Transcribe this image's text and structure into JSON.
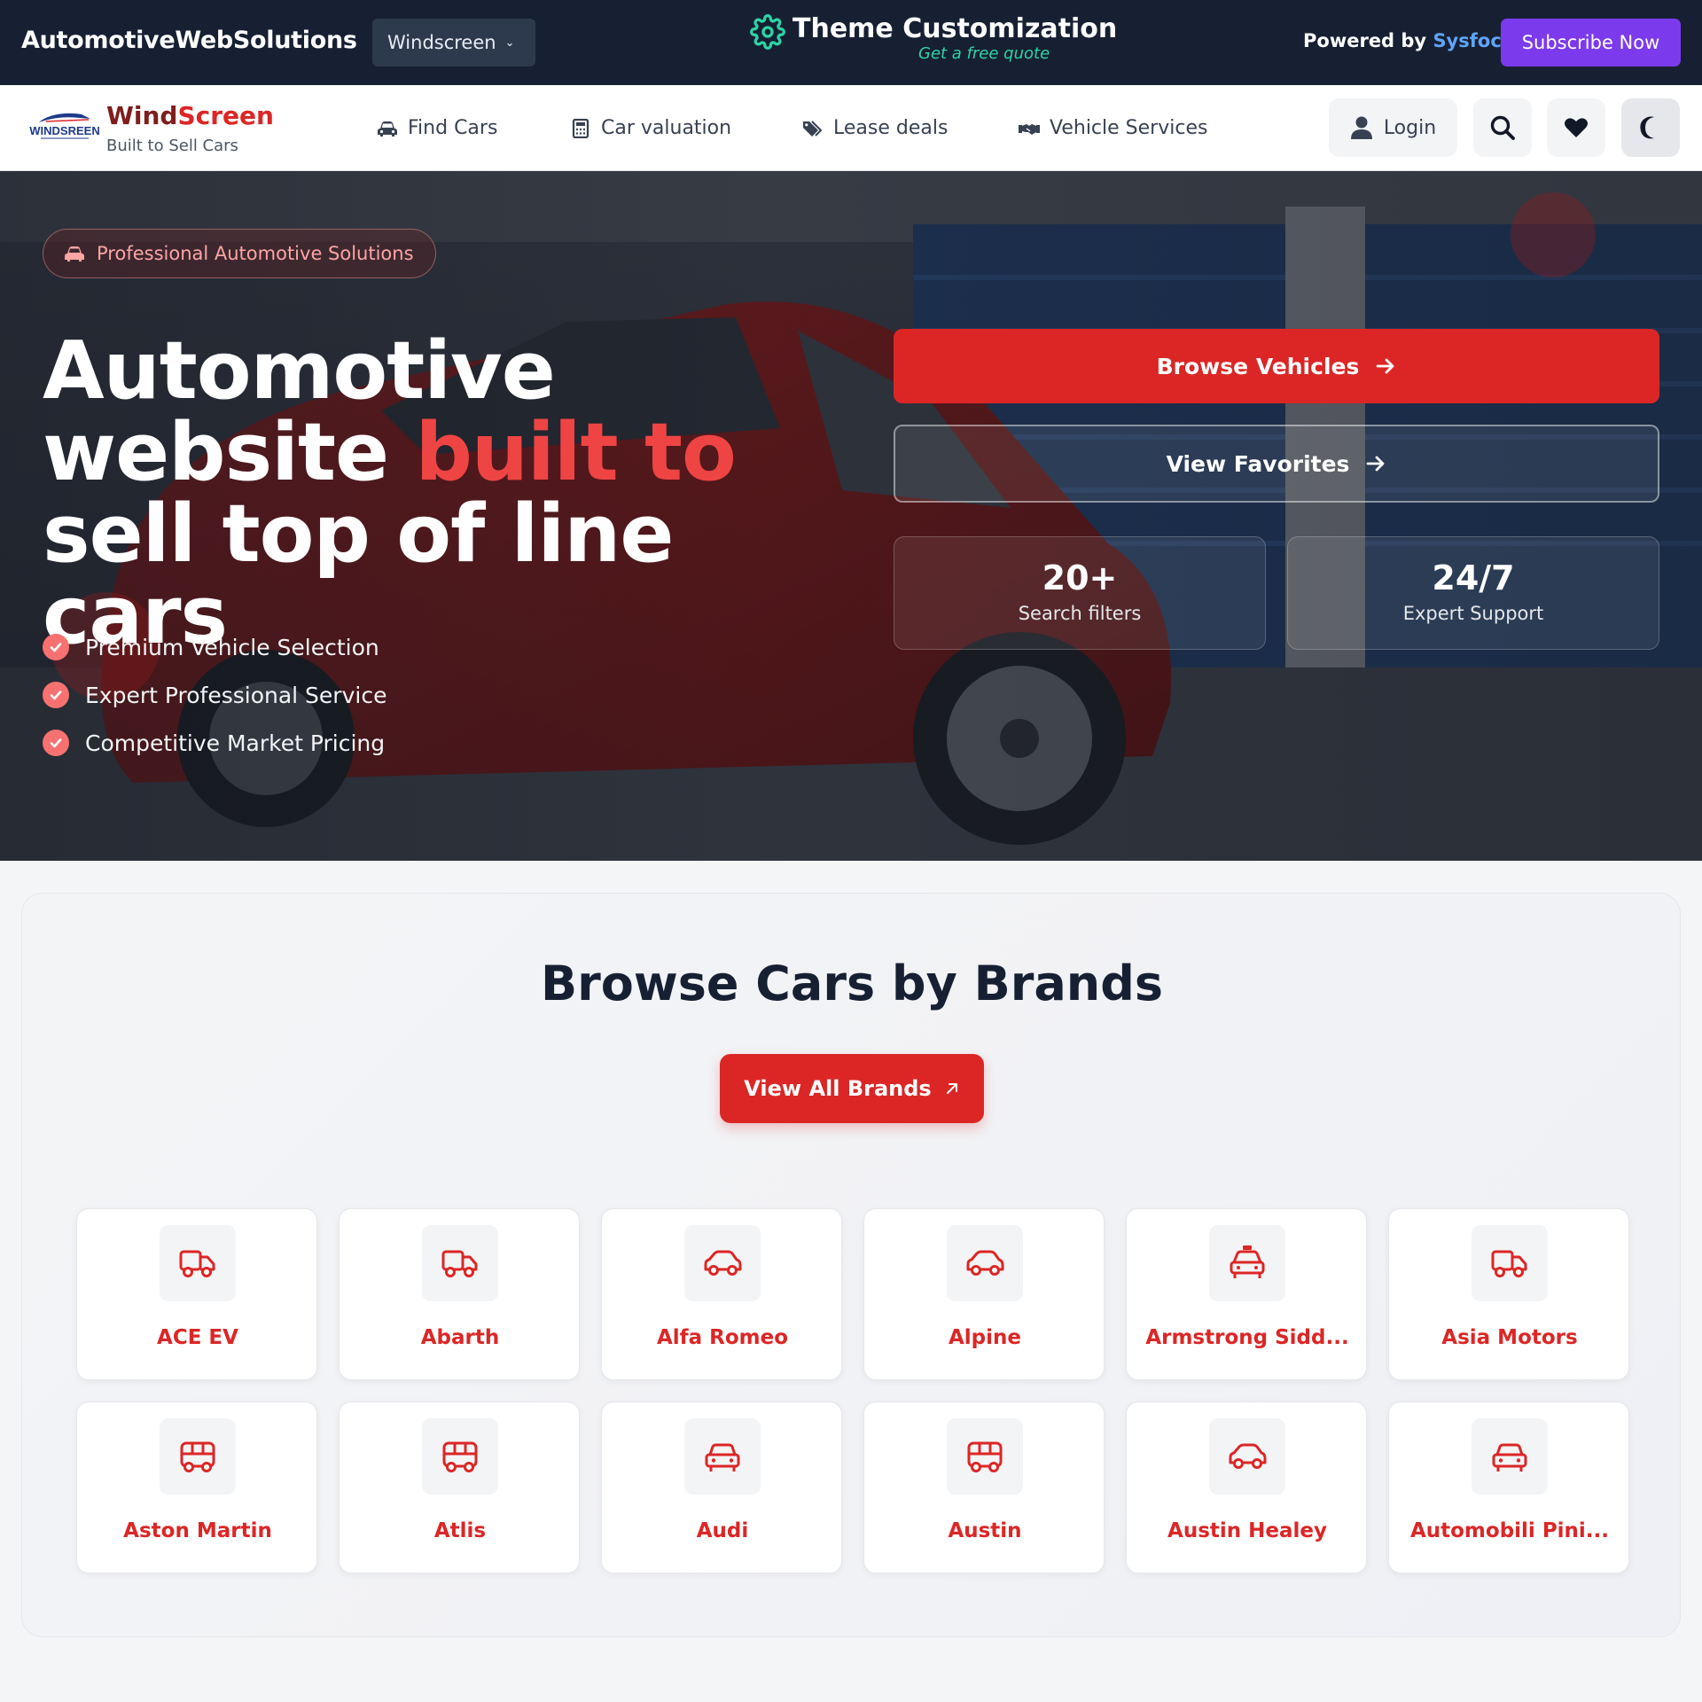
{
  "topbar": {
    "site_name": "AutomotiveWebSolutions",
    "theme_select": "Windscreen",
    "customization_title": "Theme Customization",
    "customization_sub": "Get a free quote",
    "powered_prefix": "Powered by",
    "powered_brand": "Sysfoc",
    "subscribe": "Subscribe Now"
  },
  "nav": {
    "logo_text": "WINDSREEN",
    "brand_wind": "Wind",
    "brand_screen": "Screen",
    "tagline": "Built to Sell Cars",
    "links": [
      {
        "label": "Find Cars",
        "icon": "car-icon"
      },
      {
        "label": "Car valuation",
        "icon": "calculator-icon"
      },
      {
        "label": "Lease deals",
        "icon": "tags-icon"
      },
      {
        "label": "Vehicle Services",
        "icon": "handshake-icon"
      }
    ],
    "login": "Login"
  },
  "hero": {
    "badge": "Professional Automotive Solutions",
    "headline_1": "Automotive",
    "headline_2a": "website ",
    "headline_2b": "built to",
    "headline_3": "sell top of line cars",
    "checks": [
      "Premium Vehicle Selection",
      "Expert Professional Service",
      "Competitive Market Pricing"
    ],
    "browse": "Browse Vehicles",
    "favorites": "View Favorites",
    "stats": [
      {
        "value": "20+",
        "label": "Search filters"
      },
      {
        "value": "24/7",
        "label": "Expert Support"
      }
    ]
  },
  "brands": {
    "title": "Browse Cars by Brands",
    "view_all": "View All Brands",
    "items": [
      {
        "name": "ACE EV",
        "icon": "truck-icon"
      },
      {
        "name": "Abarth",
        "icon": "truck-icon"
      },
      {
        "name": "Alfa Romeo",
        "icon": "car-side-icon"
      },
      {
        "name": "Alpine",
        "icon": "car-side-icon"
      },
      {
        "name": "Armstrong Sidd...",
        "icon": "taxi-icon"
      },
      {
        "name": "Asia Motors",
        "icon": "truck-icon"
      },
      {
        "name": "Aston Martin",
        "icon": "bus-icon"
      },
      {
        "name": "Atlis",
        "icon": "bus-icon"
      },
      {
        "name": "Audi",
        "icon": "car-front-icon"
      },
      {
        "name": "Austin",
        "icon": "bus-icon"
      },
      {
        "name": "Austin Healey",
        "icon": "car-side-icon"
      },
      {
        "name": "Automobili Pini...",
        "icon": "car-front-icon"
      }
    ]
  },
  "colors": {
    "accent_red": "#dc2626",
    "topbar_bg": "#172033",
    "subscribe_purple": "#7c3aed",
    "theme_green": "#2dd4a4"
  }
}
